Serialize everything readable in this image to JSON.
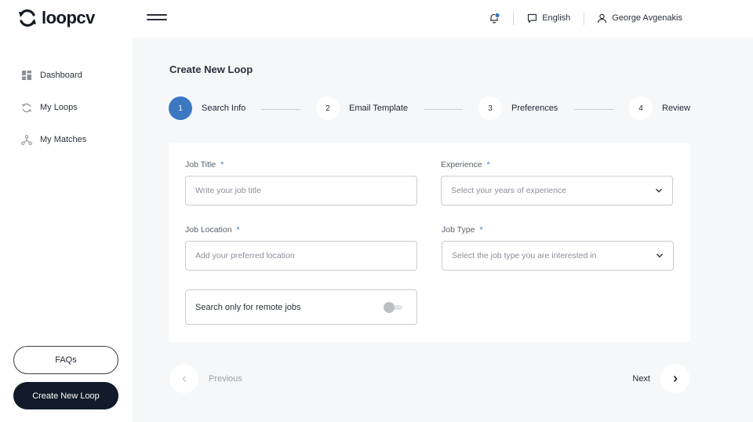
{
  "app": {
    "brand": "loopcv"
  },
  "header": {
    "language": "English",
    "user_name": "George Avgenakis",
    "notification_dot_color": "#3a78c2"
  },
  "sidebar": {
    "items": [
      {
        "label": "Dashboard",
        "icon": "dashboard-icon"
      },
      {
        "label": "My Loops",
        "icon": "loop-icon"
      },
      {
        "label": "My Matches",
        "icon": "matches-icon"
      }
    ],
    "faq_label": "FAQs",
    "create_label": "Create New Loop"
  },
  "main": {
    "title": "Create New Loop",
    "steps": [
      {
        "number": "1",
        "label": "Search Info",
        "active": true
      },
      {
        "number": "2",
        "label": "Email Template",
        "active": false
      },
      {
        "number": "3",
        "label": "Preferences",
        "active": false
      },
      {
        "number": "4",
        "label": "Review",
        "active": false
      }
    ],
    "form": {
      "job_title": {
        "label": "Job Title",
        "required": "*",
        "placeholder": "Write your job title",
        "value": ""
      },
      "experience": {
        "label": "Experience",
        "required": "*",
        "placeholder": "Select your years of experience"
      },
      "job_location": {
        "label": "Job Location",
        "required": "*",
        "placeholder": "Add your preferred location",
        "value": ""
      },
      "job_type": {
        "label": "Job Type",
        "required": "*",
        "placeholder": "Select the job type you are interested in"
      },
      "remote": {
        "label": "Search only for remote jobs",
        "enabled": false
      }
    },
    "pager": {
      "previous_label": "Previous",
      "next_label": "Next"
    }
  },
  "colors": {
    "accent": "#3a78c2",
    "dark_button": "#111b29",
    "main_bg": "#f6f7f9"
  }
}
